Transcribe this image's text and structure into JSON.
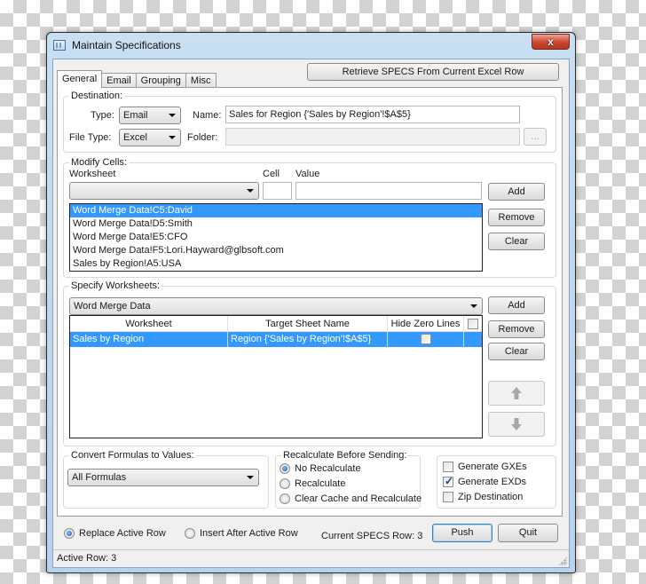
{
  "window": {
    "title": "Maintain  Specifications",
    "close_label": "x"
  },
  "tabs": [
    {
      "label": "General",
      "active": true
    },
    {
      "label": "Email",
      "active": false
    },
    {
      "label": "Grouping",
      "active": false
    },
    {
      "label": "Misc",
      "active": false
    }
  ],
  "retrieve_button": "Retrieve SPECS From Current Excel Row",
  "destination": {
    "group_label": "Destination:",
    "type_label": "Type:",
    "type_value": "Email",
    "name_label": "Name:",
    "name_value": "Sales for Region {'Sales by Region'!$A$5}",
    "file_type_label": "File Type:",
    "file_type_value": "Excel",
    "folder_label": "Folder:",
    "folder_value": "",
    "browse_label": "..."
  },
  "modify_cells": {
    "group_label": "Modify Cells:",
    "worksheet_label": "Worksheet",
    "worksheet_value": "",
    "cell_label": "Cell",
    "cell_value": "",
    "value_label": "Value",
    "value_value": "",
    "items": [
      {
        "text": "Word Merge Data!C5:David",
        "selected": true
      },
      {
        "text": "Word Merge Data!D5:Smith",
        "selected": false
      },
      {
        "text": "Word Merge Data!E5:CFO",
        "selected": false
      },
      {
        "text": "Word Merge Data!F5:Lori.Hayward@glbsoft.com",
        "selected": false
      },
      {
        "text": "Sales by Region!A5:USA",
        "selected": false
      }
    ],
    "add_label": "Add",
    "remove_label": "Remove",
    "clear_label": "Clear"
  },
  "specify_worksheets": {
    "group_label": "Specify Worksheets:",
    "selected_worksheet": "Word Merge Data",
    "columns": [
      "Worksheet",
      "Target Sheet Name",
      "Hide Zero Lines"
    ],
    "rows": [
      {
        "worksheet": "Sales by Region",
        "target": "Region {'Sales by Region'!$A$5}",
        "hide_zero_lines": false
      }
    ],
    "header_checkbox_checked": false,
    "add_label": "Add",
    "remove_label": "Remove",
    "clear_label": "Clear",
    "move_up_icon": "arrow-up",
    "move_down_icon": "arrow-down"
  },
  "convert_formulas": {
    "group_label": "Convert Formulas to Values:",
    "value": "All Formulas"
  },
  "recalculate": {
    "group_label": "Recalculate Before Sending:",
    "options": [
      {
        "label": "No Recalculate",
        "checked": true
      },
      {
        "label": "Recalculate",
        "checked": false
      },
      {
        "label": "Clear Cache and Recalculate",
        "checked": false
      }
    ]
  },
  "generate_options": [
    {
      "label": "Generate GXEs",
      "checked": false
    },
    {
      "label": "Generate EXDs",
      "checked": true
    },
    {
      "label": "Zip Destination",
      "checked": false
    }
  ],
  "footer": {
    "replace_label": "Replace Active Row",
    "replace_checked": true,
    "insert_label": "Insert After Active Row",
    "insert_checked": false,
    "current_specs_row": "Current SPECS Row: 3",
    "push_label": "Push",
    "quit_label": "Quit"
  },
  "status": {
    "active_row": "Active Row: 3"
  }
}
